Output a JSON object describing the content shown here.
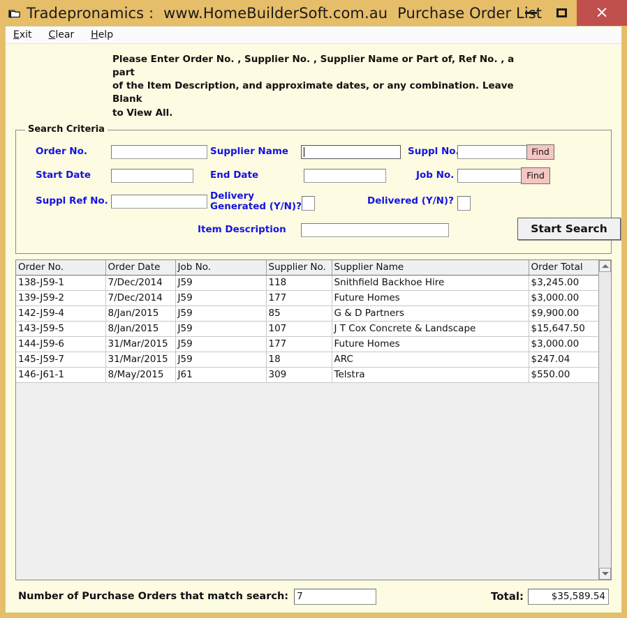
{
  "window": {
    "title_app": "Tradepronamics :",
    "title_site": "www.HomeBuilderSoft.com.au",
    "title_screen": "Purchase Order List",
    "icon": "window-folder-icon",
    "minimize_label": "",
    "maximize_label": "",
    "close_label": "×",
    "titlebar_color": "#e6bd68",
    "close_color": "#c0504d",
    "body_color": "#fdfbe2"
  },
  "menu": {
    "items": [
      {
        "mnemonic": "E",
        "rest": "xit",
        "name": "exit"
      },
      {
        "mnemonic": "C",
        "rest": "lear",
        "name": "clear"
      },
      {
        "mnemonic": "H",
        "rest": "elp",
        "name": "help"
      }
    ]
  },
  "instructions": {
    "line1": "Please Enter Order No. , Supplier No. , Supplier Name or Part of, Ref No. , a part",
    "line2": "of the Item Description, and approximate dates, or any combination. Leave Blank",
    "line3": "to View All."
  },
  "search": {
    "legend": "Search Criteria",
    "label_color": "#1414e0",
    "order_no": {
      "label": "Order No.",
      "value": "",
      "placeholder": ""
    },
    "supplier_name": {
      "label": "Supplier Name",
      "value": "",
      "placeholder": "",
      "focused": true
    },
    "suppl_no": {
      "label": "Suppl No.",
      "value": "",
      "placeholder": "",
      "find_label": "Find"
    },
    "start_date": {
      "label": "Start Date",
      "value": "",
      "placeholder": "",
      "picker_label": "..."
    },
    "end_date": {
      "label": "End Date",
      "value": "",
      "placeholder": "",
      "picker_label": "..."
    },
    "job_no": {
      "label": "Job No.",
      "value": "",
      "placeholder": "",
      "find_label": "Find"
    },
    "suppl_ref_no": {
      "label": "Suppl Ref No.",
      "value": "",
      "placeholder": ""
    },
    "delivery_generated": {
      "label_line1": "Delivery",
      "label_line2": "Generated (Y/N)?",
      "value": ""
    },
    "delivered": {
      "label": "Delivered (Y/N)?",
      "value": ""
    },
    "item_description": {
      "label": "Item Description",
      "value": "",
      "placeholder": ""
    },
    "start_search_label": "Start Search"
  },
  "grid": {
    "columns": [
      "Order No.",
      "Order Date",
      "Job No.",
      "Supplier No.",
      "Supplier Name",
      "Order Total"
    ],
    "rows": [
      [
        "138-J59-1",
        "7/Dec/2014",
        "J59",
        "118",
        "Snithfield Backhoe Hire",
        "$3,245.00"
      ],
      [
        "139-J59-2",
        "7/Dec/2014",
        "J59",
        "177",
        "Future Homes",
        "$3,000.00"
      ],
      [
        "142-J59-4",
        "8/Jan/2015",
        "J59",
        "85",
        "G & D Partners",
        "$9,900.00"
      ],
      [
        "143-J59-5",
        "8/Jan/2015",
        "J59",
        "107",
        "J T Cox Concrete & Landscape",
        "$15,647.50"
      ],
      [
        "144-J59-6",
        "31/Mar/2015",
        "J59",
        "177",
        "Future Homes",
        "$3,000.00"
      ],
      [
        "145-J59-7",
        "31/Mar/2015",
        "J59",
        "18",
        "ARC",
        "$247.04"
      ],
      [
        "146-J61-1",
        "8/May/2015",
        "J61",
        "309",
        "Telstra",
        "$550.00"
      ]
    ],
    "scroll_up_icon": "scroll-up-arrow-icon",
    "scroll_down_icon": "scroll-down-arrow-icon"
  },
  "footer": {
    "count_label": "Number of Purchase Orders that match search:",
    "count_value": "7",
    "total_label": "Total:",
    "total_value": "$35,589.54"
  }
}
